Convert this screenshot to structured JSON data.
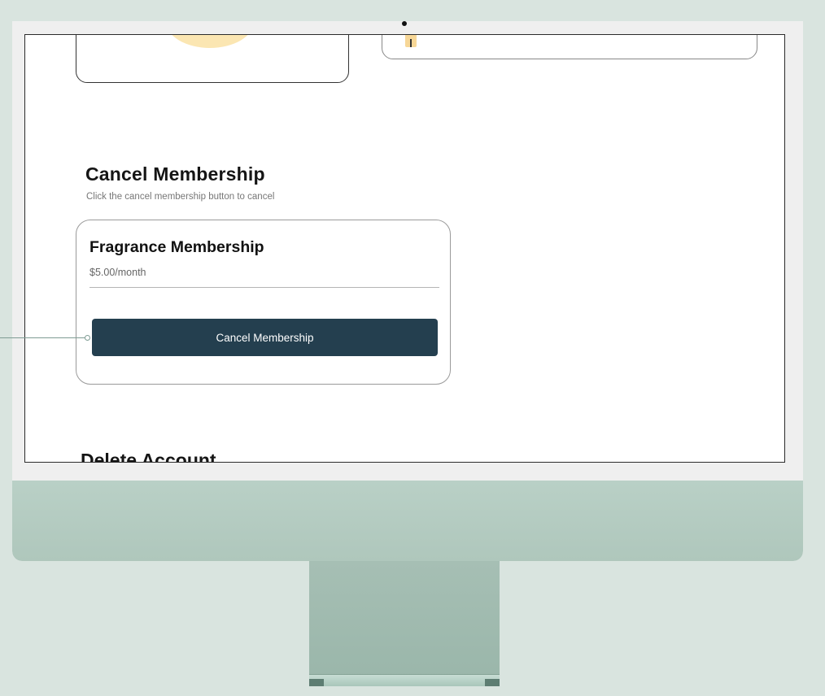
{
  "cancel_section": {
    "title": "Cancel Membership",
    "subtitle": "Click the cancel membership button to cancel"
  },
  "membership": {
    "name": "Fragrance Membership",
    "price": "$5.00/month",
    "cancel_button_label": "Cancel Membership"
  },
  "next_section": {
    "title": "Delete Account"
  },
  "colors": {
    "page_background": "#d9e4df",
    "monitor_chin": "#b9d0c6",
    "primary_button": "#243f4f",
    "accent_yellow": "#fbe6b2"
  }
}
